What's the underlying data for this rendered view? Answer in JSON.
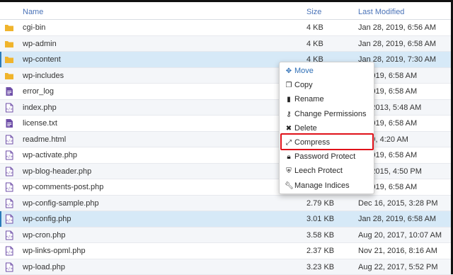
{
  "columns": {
    "name": "Name",
    "size": "Size",
    "modified": "Last Modified"
  },
  "files": [
    {
      "name": "cgi-bin",
      "size": "4 KB",
      "modified": "Jan 28, 2019, 6:56 AM",
      "icon": "folder-icon"
    },
    {
      "name": "wp-admin",
      "size": "4 KB",
      "modified": "Jan 28, 2019, 6:58 AM",
      "icon": "folder-icon"
    },
    {
      "name": "wp-content",
      "size": "4 KB",
      "modified": "Jan 28, 2019, 7:30 AM",
      "icon": "folder-icon",
      "selected": true
    },
    {
      "name": "wp-includes",
      "size": "",
      "modified": "8, 2019, 6:58 AM",
      "icon": "folder-icon"
    },
    {
      "name": "error_log",
      "size": "",
      "modified": "8, 2019, 6:58 AM",
      "icon": "text-file-icon"
    },
    {
      "name": "index.php",
      "size": "",
      "modified": "25, 2013, 5:48 AM",
      "icon": "code-file-icon"
    },
    {
      "name": "license.txt",
      "size": "",
      "modified": "8, 2019, 6:58 AM",
      "icon": "text-file-icon"
    },
    {
      "name": "readme.html",
      "size": "",
      "modified": "2019, 4:20 AM",
      "icon": "code-file-icon"
    },
    {
      "name": "wp-activate.php",
      "size": "",
      "modified": "8, 2019, 6:58 AM",
      "icon": "code-file-icon"
    },
    {
      "name": "wp-blog-header.php",
      "size": "",
      "modified": "19, 2015, 4:50 PM",
      "icon": "code-file-icon"
    },
    {
      "name": "wp-comments-post.php",
      "size": "",
      "modified": "8, 2019, 6:58 AM",
      "icon": "code-file-icon"
    },
    {
      "name": "wp-config-sample.php",
      "size": "2.79 KB",
      "modified": "Dec 16, 2015, 3:28 PM",
      "icon": "code-file-icon"
    },
    {
      "name": "wp-config.php",
      "size": "3.01 KB",
      "modified": "Jan 28, 2019, 6:58 AM",
      "icon": "code-file-icon",
      "selected": true
    },
    {
      "name": "wp-cron.php",
      "size": "3.58 KB",
      "modified": "Aug 20, 2017, 10:07 AM",
      "icon": "code-file-icon"
    },
    {
      "name": "wp-links-opml.php",
      "size": "2.37 KB",
      "modified": "Nov 21, 2016, 8:16 AM",
      "icon": "code-file-icon"
    },
    {
      "name": "wp-load.php",
      "size": "3.23 KB",
      "modified": "Aug 22, 2017, 5:52 PM",
      "icon": "code-file-icon"
    }
  ],
  "context_menu": {
    "items": [
      {
        "label": "Move",
        "icon": "move-icon"
      },
      {
        "label": "Copy",
        "icon": "copy-icon"
      },
      {
        "label": "Rename",
        "icon": "rename-icon"
      },
      {
        "label": "Change Permissions",
        "icon": "key-icon"
      },
      {
        "label": "Delete",
        "icon": "delete-icon"
      },
      {
        "label": "Compress",
        "icon": "compress-icon"
      },
      {
        "label": "Password Protect",
        "icon": "lock-icon"
      },
      {
        "label": "Leech Protect",
        "icon": "shield-icon"
      },
      {
        "label": "Manage Indices",
        "icon": "wrench-icon"
      }
    ],
    "highlighted": "Compress"
  },
  "colors": {
    "accent": "#4a73b8",
    "highlight_border": "#e0121a",
    "folder": "#f0b42c",
    "file": "#6f4fa8"
  }
}
